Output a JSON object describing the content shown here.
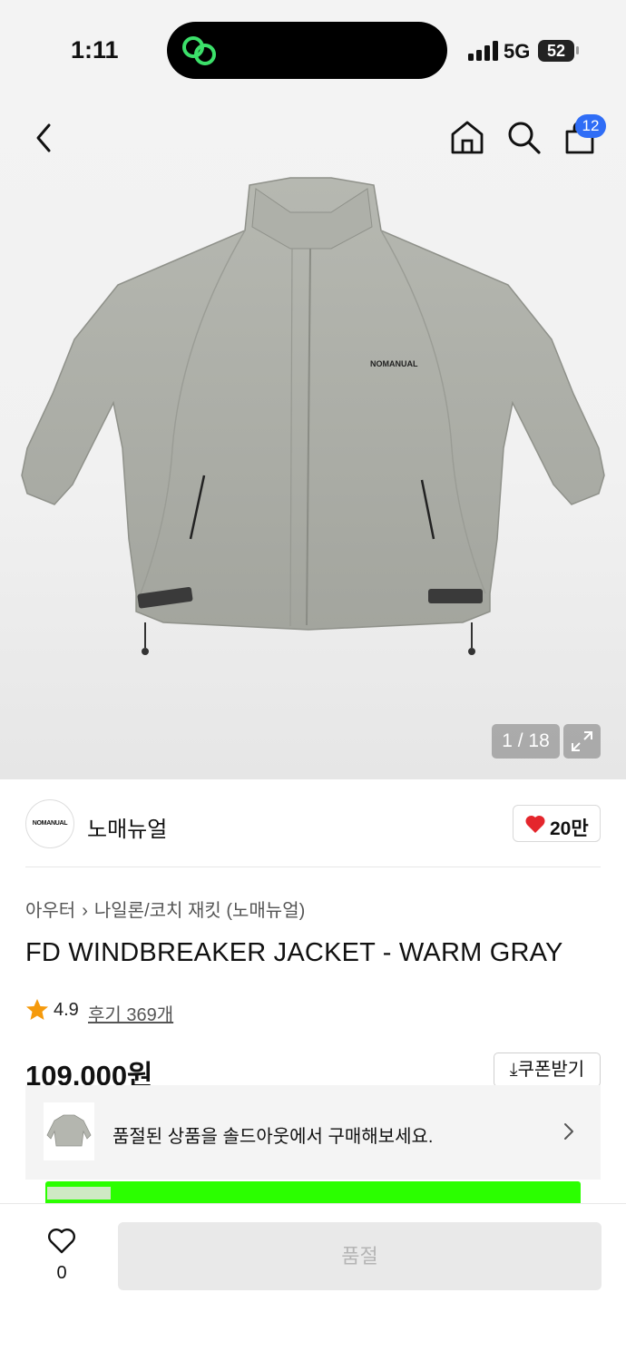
{
  "status_bar": {
    "time": "1:11",
    "network": "5G",
    "battery": "52"
  },
  "top_nav": {
    "cart_badge": "12"
  },
  "gallery": {
    "counter": "1 / 18",
    "jacket_logo": "NOMANUAL"
  },
  "brand": {
    "logo_text": "NOMANUAL",
    "name": "노매뉴얼",
    "likes": "20만"
  },
  "breadcrumb": {
    "level1": "아우터",
    "separator": "›",
    "level2": "나일론/코치 재킷 (노매뉴얼)"
  },
  "product": {
    "title": "FD WINDBREAKER JACKET - WARM GRAY",
    "rating": "4.9",
    "review_link": "후기 369개",
    "price": "109,000원",
    "coupon_label": "쿠폰받기"
  },
  "soldout_banner": {
    "text": "품절된 상품을 솔드아웃에서 구매해보세요."
  },
  "bottom_bar": {
    "wish_count": "0",
    "buy_label": "품절"
  },
  "colors": {
    "accent_blue": "#2f6df6",
    "heart_red": "#e4262c",
    "star_orange": "#f59a0c",
    "banner_green": "#2bff00"
  }
}
